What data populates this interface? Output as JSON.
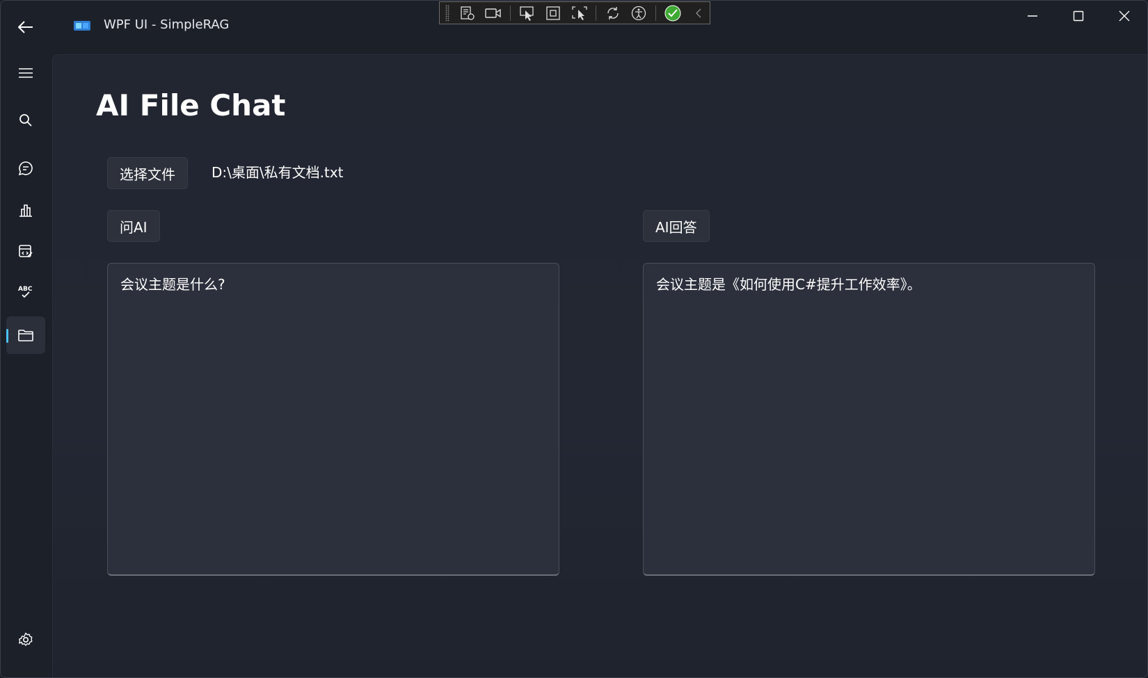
{
  "window": {
    "title": "WPF UI - SimpleRAG"
  },
  "page": {
    "title": "AI File Chat"
  },
  "file": {
    "select_button": "选择文件",
    "path": "D:\\桌面\\私有文档.txt"
  },
  "question": {
    "button": "问AI",
    "text": "会议主题是什么?"
  },
  "answer": {
    "button": "AI回答",
    "text": "会议主题是《如何使用C#提升工作效率》。"
  },
  "nav": {
    "items": [
      "menu-icon",
      "search-icon",
      "chat-icon",
      "chart-icon",
      "code-icon",
      "spellcheck-icon",
      "folder-icon"
    ],
    "active": "folder-icon",
    "footer": "settings-icon"
  },
  "colors": {
    "accent": "#4cc2ff",
    "background": "#1c2029",
    "content": "#232733",
    "button": "#2d313c"
  }
}
